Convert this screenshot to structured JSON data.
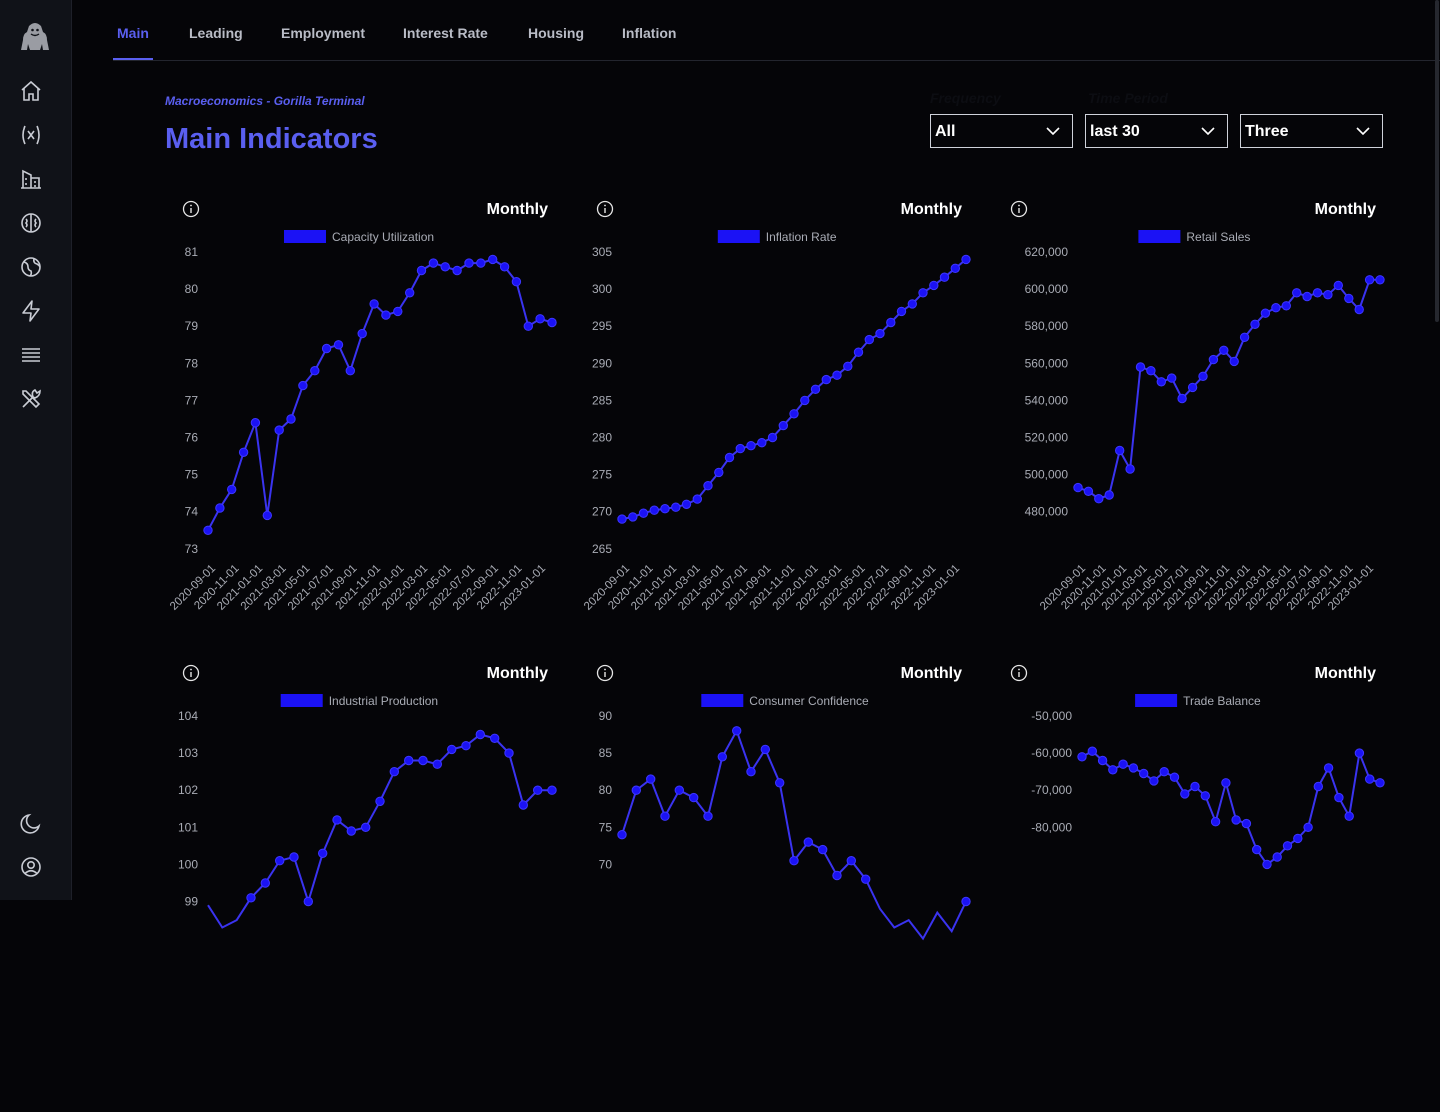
{
  "app": {
    "brand_icon": "gorilla-logo"
  },
  "sidebar": {
    "icons": [
      "home-icon",
      "variable-icon",
      "buildings-icon",
      "brain-icon",
      "globe-icon",
      "lightning-icon",
      "list-icon",
      "tools-icon",
      "moon-icon",
      "user-icon"
    ]
  },
  "nav": {
    "tabs": [
      {
        "label": "Main",
        "active": true
      },
      {
        "label": "Leading",
        "active": false
      },
      {
        "label": "Employment",
        "active": false
      },
      {
        "label": "Interest Rate",
        "active": false
      },
      {
        "label": "Housing",
        "active": false
      },
      {
        "label": "Inflation",
        "active": false
      }
    ]
  },
  "header": {
    "subtitle": "Macroeconomics - Gorilla Terminal",
    "title": "Main Indicators"
  },
  "filters": {
    "frequency_label": "Frequency",
    "time_label": "Time Period",
    "selects": [
      {
        "value": "All"
      },
      {
        "value": "last 30"
      },
      {
        "value": "Three"
      }
    ]
  },
  "colors": {
    "accent": "#5a5ff0",
    "series": "#1b12f5",
    "background": "#050508"
  },
  "chart_data": [
    {
      "type": "line",
      "frequency": "Monthly",
      "legend": "Capacity Utilization",
      "x_ticks": [
        "2020-09-01",
        "2020-11-01",
        "2021-01-01",
        "2021-03-01",
        "2021-05-01",
        "2021-07-01",
        "2021-09-01",
        "2021-11-01",
        "2022-01-01",
        "2022-03-01",
        "2022-05-01",
        "2022-07-01",
        "2022-09-01",
        "2022-11-01",
        "2023-01-01"
      ],
      "y_ticks": [
        "81",
        "80",
        "79",
        "78",
        "77",
        "76",
        "75",
        "74",
        "73"
      ],
      "ylim": [
        73,
        81
      ],
      "values": [
        73.5,
        74.1,
        74.6,
        75.6,
        76.4,
        73.9,
        76.2,
        76.5,
        77.4,
        77.8,
        78.4,
        78.5,
        77.8,
        78.8,
        79.6,
        79.3,
        79.4,
        79.9,
        80.5,
        80.7,
        80.6,
        80.5,
        80.7,
        80.7,
        80.8,
        80.6,
        80.2,
        79.0,
        79.2,
        79.1
      ]
    },
    {
      "type": "line",
      "frequency": "Monthly",
      "legend": "Inflation Rate",
      "x_ticks": [
        "2020-09-01",
        "2020-11-01",
        "2021-01-01",
        "2021-03-01",
        "2021-05-01",
        "2021-07-01",
        "2021-09-01",
        "2021-11-01",
        "2022-01-01",
        "2022-03-01",
        "2022-05-01",
        "2022-07-01",
        "2022-09-01",
        "2022-11-01",
        "2023-01-01"
      ],
      "y_ticks": [
        "305",
        "300",
        "295",
        "290",
        "285",
        "280",
        "275",
        "270",
        "265"
      ],
      "ylim": [
        265,
        305
      ],
      "values": [
        269.0,
        269.3,
        269.8,
        270.2,
        270.4,
        270.6,
        271.0,
        271.7,
        273.5,
        275.3,
        277.3,
        278.5,
        278.9,
        279.3,
        280.0,
        281.6,
        283.2,
        285.0,
        286.5,
        287.8,
        288.4,
        289.6,
        291.5,
        293.2,
        294.0,
        295.5,
        297.0,
        298.0,
        299.5,
        300.5,
        301.6,
        302.8,
        304.0
      ]
    },
    {
      "type": "line",
      "frequency": "Monthly",
      "legend": "Retail Sales",
      "x_ticks": [
        "2020-09-01",
        "2020-11-01",
        "2021-01-01",
        "2021-03-01",
        "2021-05-01",
        "2021-07-01",
        "2021-09-01",
        "2021-11-01",
        "2022-01-01",
        "2022-03-01",
        "2022-05-01",
        "2022-07-01",
        "2022-09-01",
        "2022-11-01",
        "2023-01-01"
      ],
      "y_ticks": [
        "620,000",
        "600,000",
        "580,000",
        "560,000",
        "540,000",
        "520,000",
        "500,000",
        "480,000"
      ],
      "ylim": [
        480000,
        620000
      ],
      "values": [
        493000,
        491000,
        487000,
        489000,
        513000,
        503000,
        558000,
        556000,
        550000,
        552000,
        541000,
        547000,
        553000,
        562000,
        567000,
        561000,
        574000,
        581000,
        587000,
        590000,
        591000,
        598000,
        596000,
        598000,
        597000,
        602000,
        595000,
        589000,
        605000,
        605000
      ]
    },
    {
      "type": "line",
      "frequency": "Monthly",
      "legend": "Industrial Production",
      "x_ticks": [],
      "y_ticks": [
        "104",
        "103",
        "102",
        "101",
        "100",
        "99"
      ],
      "ylim": [
        98.5,
        104
      ],
      "values": [
        98.9,
        98.3,
        98.5,
        99.1,
        99.5,
        100.1,
        100.2,
        99.0,
        100.3,
        101.2,
        100.9,
        101.0,
        101.7,
        102.5,
        102.8,
        102.8,
        102.7,
        103.1,
        103.2,
        103.5,
        103.4,
        103.0,
        101.6,
        102.0,
        102.0
      ]
    },
    {
      "type": "line",
      "frequency": "Monthly",
      "legend": "Consumer Confidence",
      "x_ticks": [],
      "y_ticks": [
        "90",
        "85",
        "80",
        "75",
        "70"
      ],
      "ylim": [
        65,
        90
      ],
      "values": [
        74.0,
        80.0,
        81.5,
        76.5,
        80.0,
        79.0,
        76.5,
        84.5,
        88.0,
        82.5,
        85.5,
        81.0,
        70.5,
        73.0,
        72.0,
        68.5,
        70.5,
        68.0,
        64.0,
        61.5,
        62.5,
        60.0,
        63.5,
        61.0,
        65.0
      ]
    },
    {
      "type": "line",
      "frequency": "Monthly",
      "legend": "Trade Balance",
      "x_ticks": [],
      "y_ticks": [
        "-50,000",
        "-60,000",
        "-70,000",
        "-80,000"
      ],
      "ylim": [
        -86000,
        -50000
      ],
      "values": [
        -61000,
        -59500,
        -62000,
        -64500,
        -63000,
        -64000,
        -65500,
        -67500,
        -65000,
        -66500,
        -71000,
        -69000,
        -71500,
        -78500,
        -68000,
        -78000,
        -79000,
        -86000,
        -90000,
        -88000,
        -85000,
        -83000,
        -80000,
        -69000,
        -64000,
        -72000,
        -77000,
        -60000,
        -67000,
        -68000
      ]
    }
  ]
}
